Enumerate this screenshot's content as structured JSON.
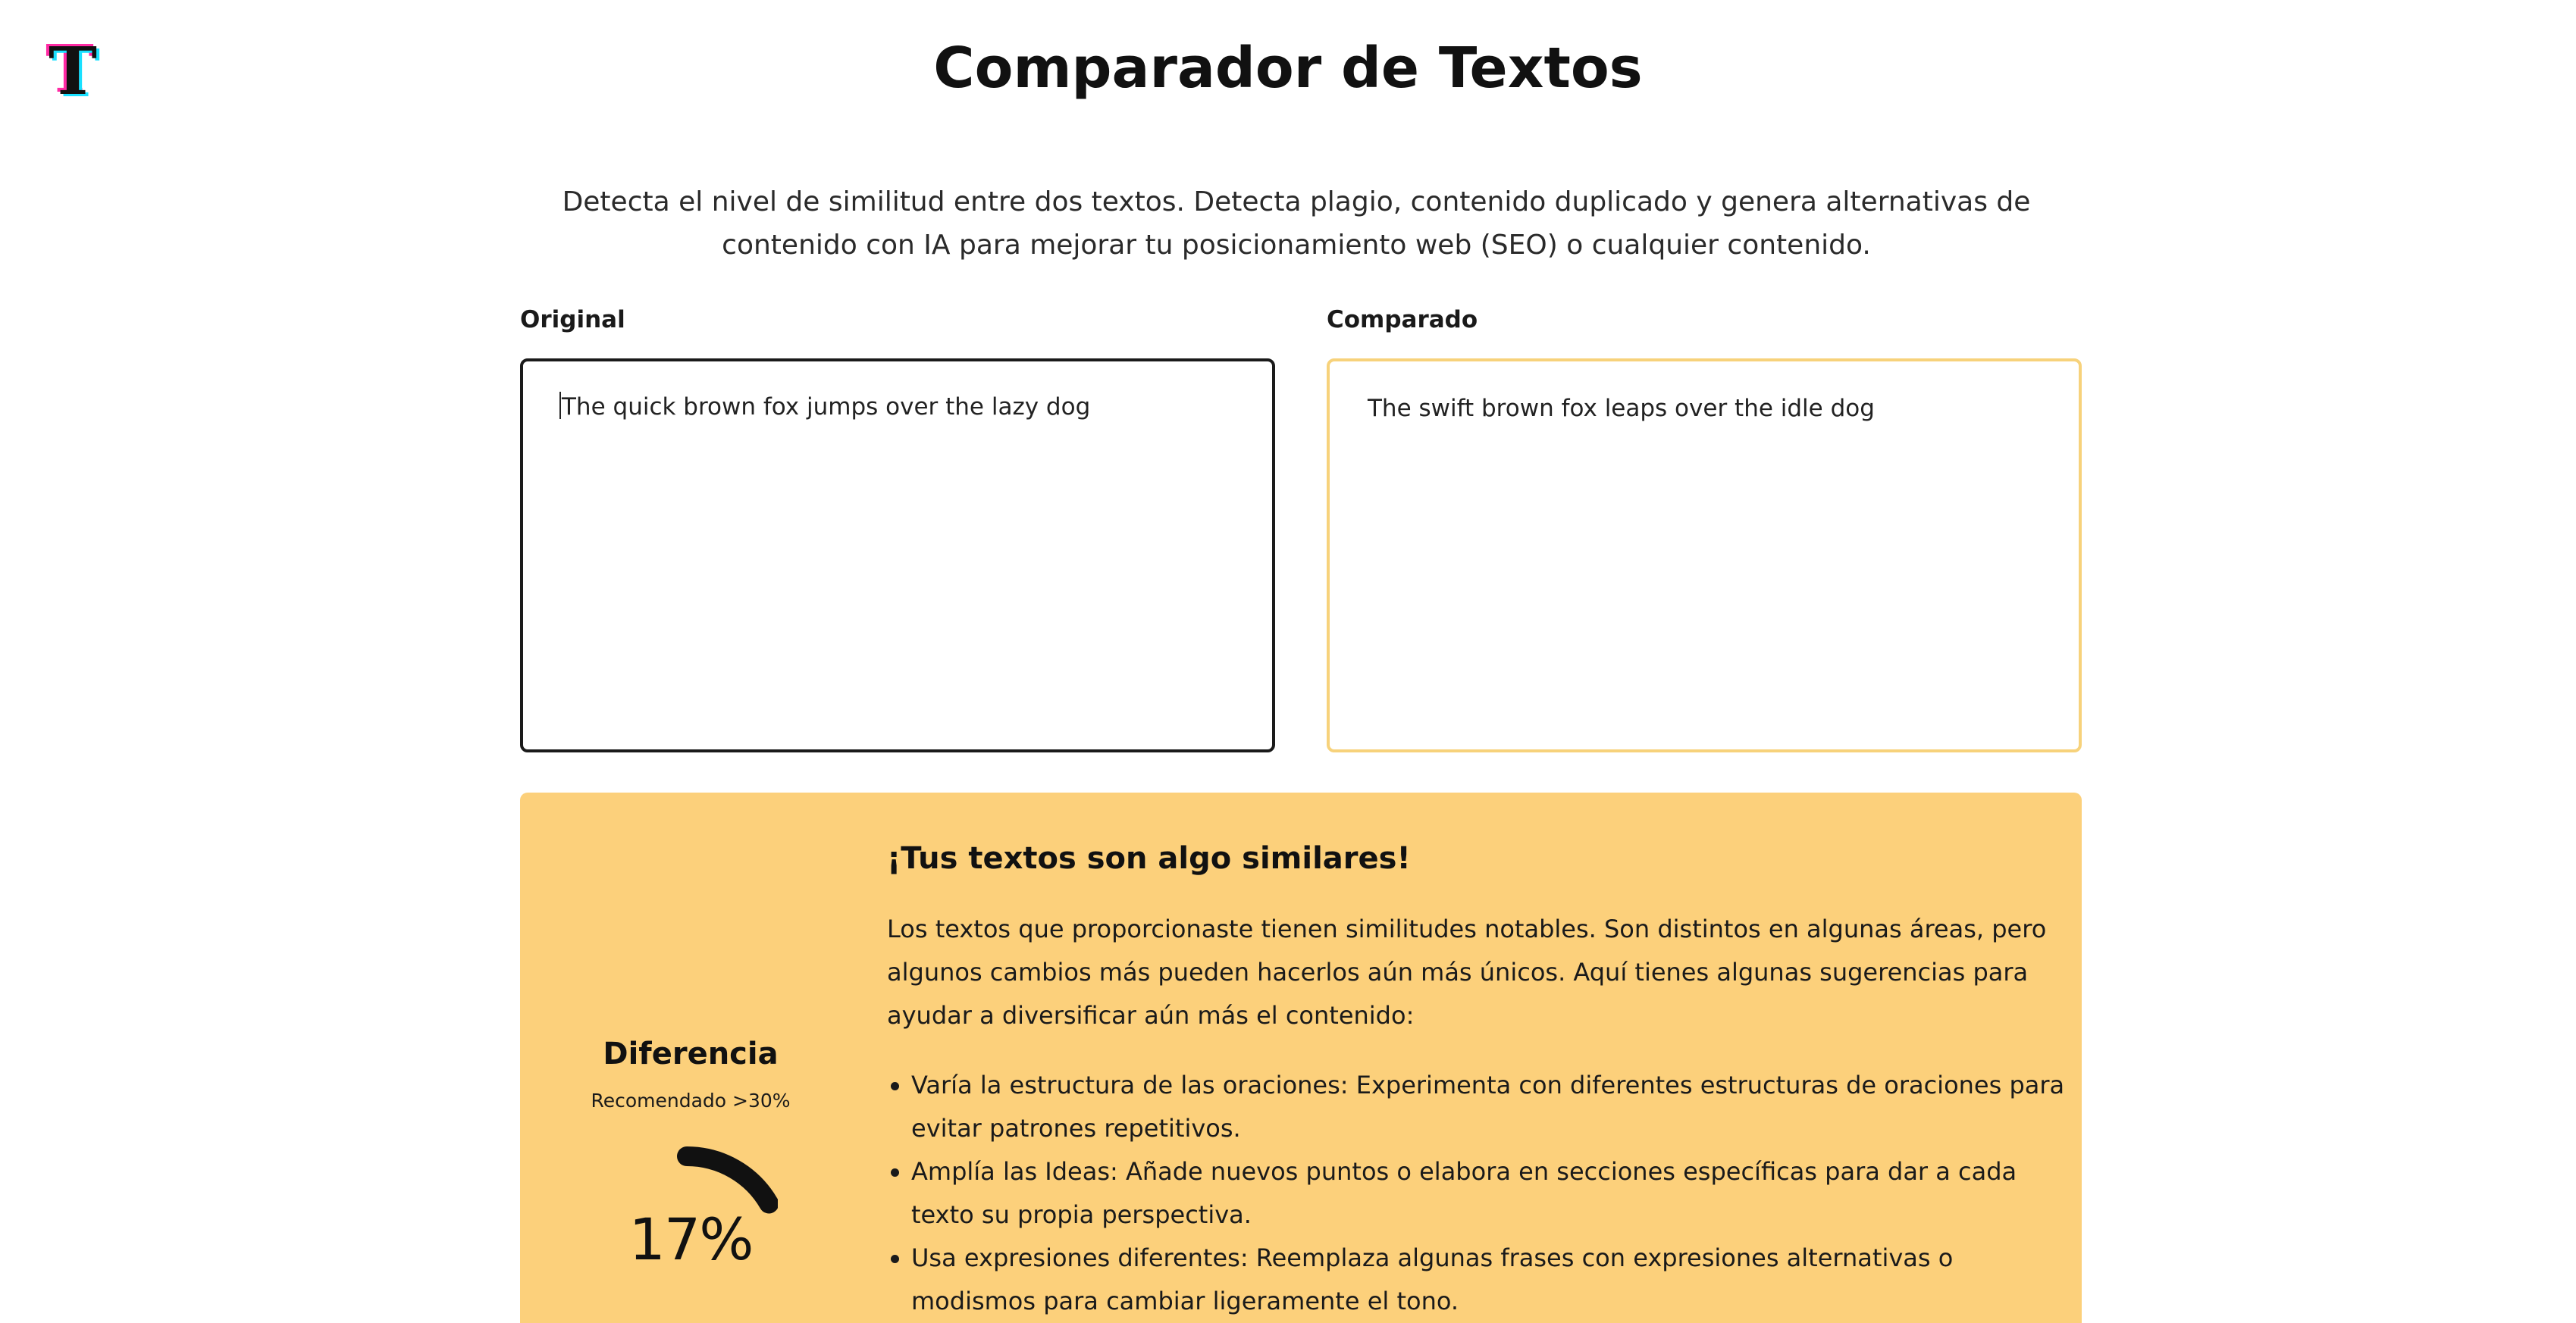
{
  "logo": {
    "letter": "T",
    "icon": "t-logo-icon"
  },
  "header": {
    "title": "Comparador de Textos"
  },
  "intro": {
    "description": "Detecta el nivel de similitud entre dos textos. Detecta plagio, contenido duplicado y genera alternativas de contenido con IA para mejorar tu posicionamiento web (SEO) o cualquier contenido."
  },
  "inputs": {
    "original_label": "Original",
    "original_value": "The quick brown fox jumps over the lazy dog",
    "compared_label": "Comparado",
    "compared_value": "The swift brown fox leaps over the idle dog"
  },
  "result": {
    "gauge": {
      "title": "Diferencia",
      "subtitle": "Recomendado >30%",
      "value_text": "17%",
      "value": 17
    },
    "heading": "¡Tus textos son algo similares!",
    "paragraph": "Los textos que proporcionaste tienen similitudes notables. Son distintos en algunas áreas, pero algunos cambios más pueden hacerlos aún más únicos. Aquí tienes algunas sugerencias para ayudar a diversificar aún más el contenido:",
    "suggestions": [
      "Varía la estructura de las oraciones: Experimenta con diferentes estructuras de oraciones para evitar patrones repetitivos.",
      "Amplía las Ideas: Añade nuevos puntos o elabora en secciones específicas para dar a cada texto su propia perspectiva.",
      "Usa expresiones diferentes: Reemplaza algunas frases con expresiones alternativas o modismos para cambiar ligeramente el tono."
    ]
  },
  "colors": {
    "panel_background": "#fcd07b",
    "compared_border": "#f7d27b",
    "original_border": "#1a1a1a",
    "gauge_stroke": "#111111"
  }
}
